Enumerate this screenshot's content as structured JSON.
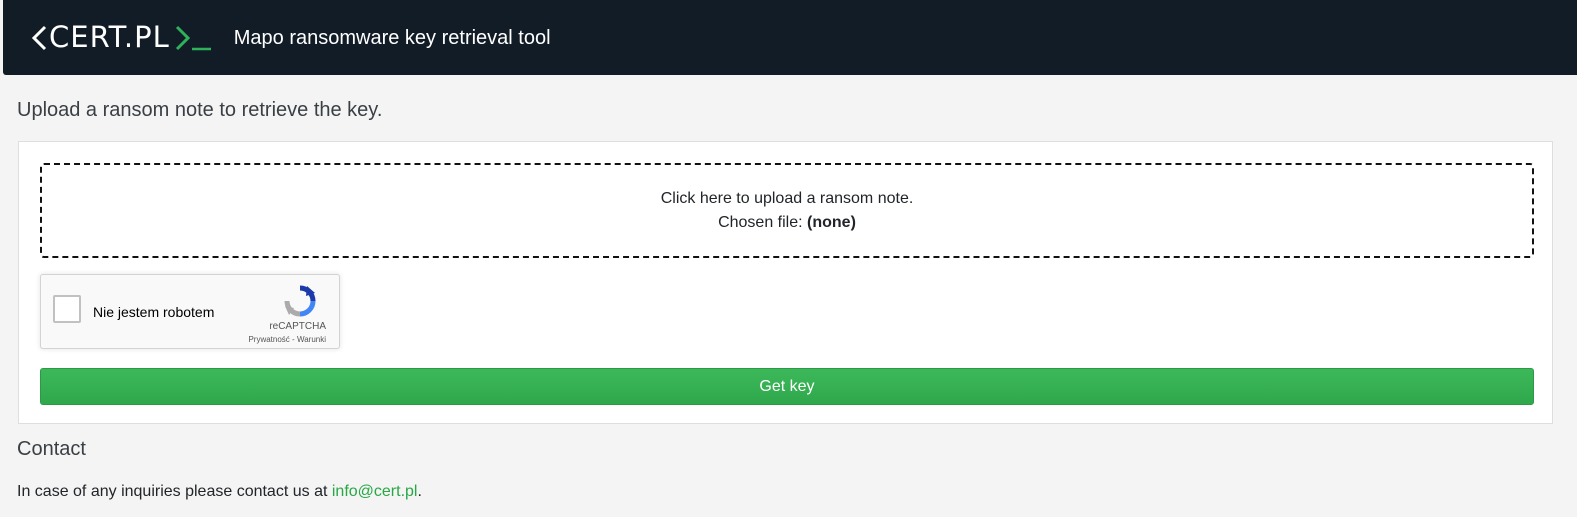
{
  "header": {
    "logo_text": "CERT.PL",
    "title": "Mapo ransomware key retrieval tool"
  },
  "main": {
    "lead": "Upload a ransom note to retrieve the key.",
    "upload": {
      "prompt": "Click here to upload a ransom note.",
      "chosen_label": "Chosen file:",
      "chosen_value": "(none)"
    },
    "recaptcha": {
      "label": "Nie jestem robotem",
      "brand": "reCAPTCHA",
      "privacy": "Prywatność",
      "separator": "-",
      "terms": "Warunki"
    },
    "submit_label": "Get key"
  },
  "contact": {
    "heading": "Contact",
    "text_before": "In case of any inquiries please contact us at",
    "email": "info@cert.pl",
    "text_after": "."
  },
  "colors": {
    "navbar": "#121c27",
    "accent_green": "#28a745",
    "button_green": "#36b055"
  }
}
